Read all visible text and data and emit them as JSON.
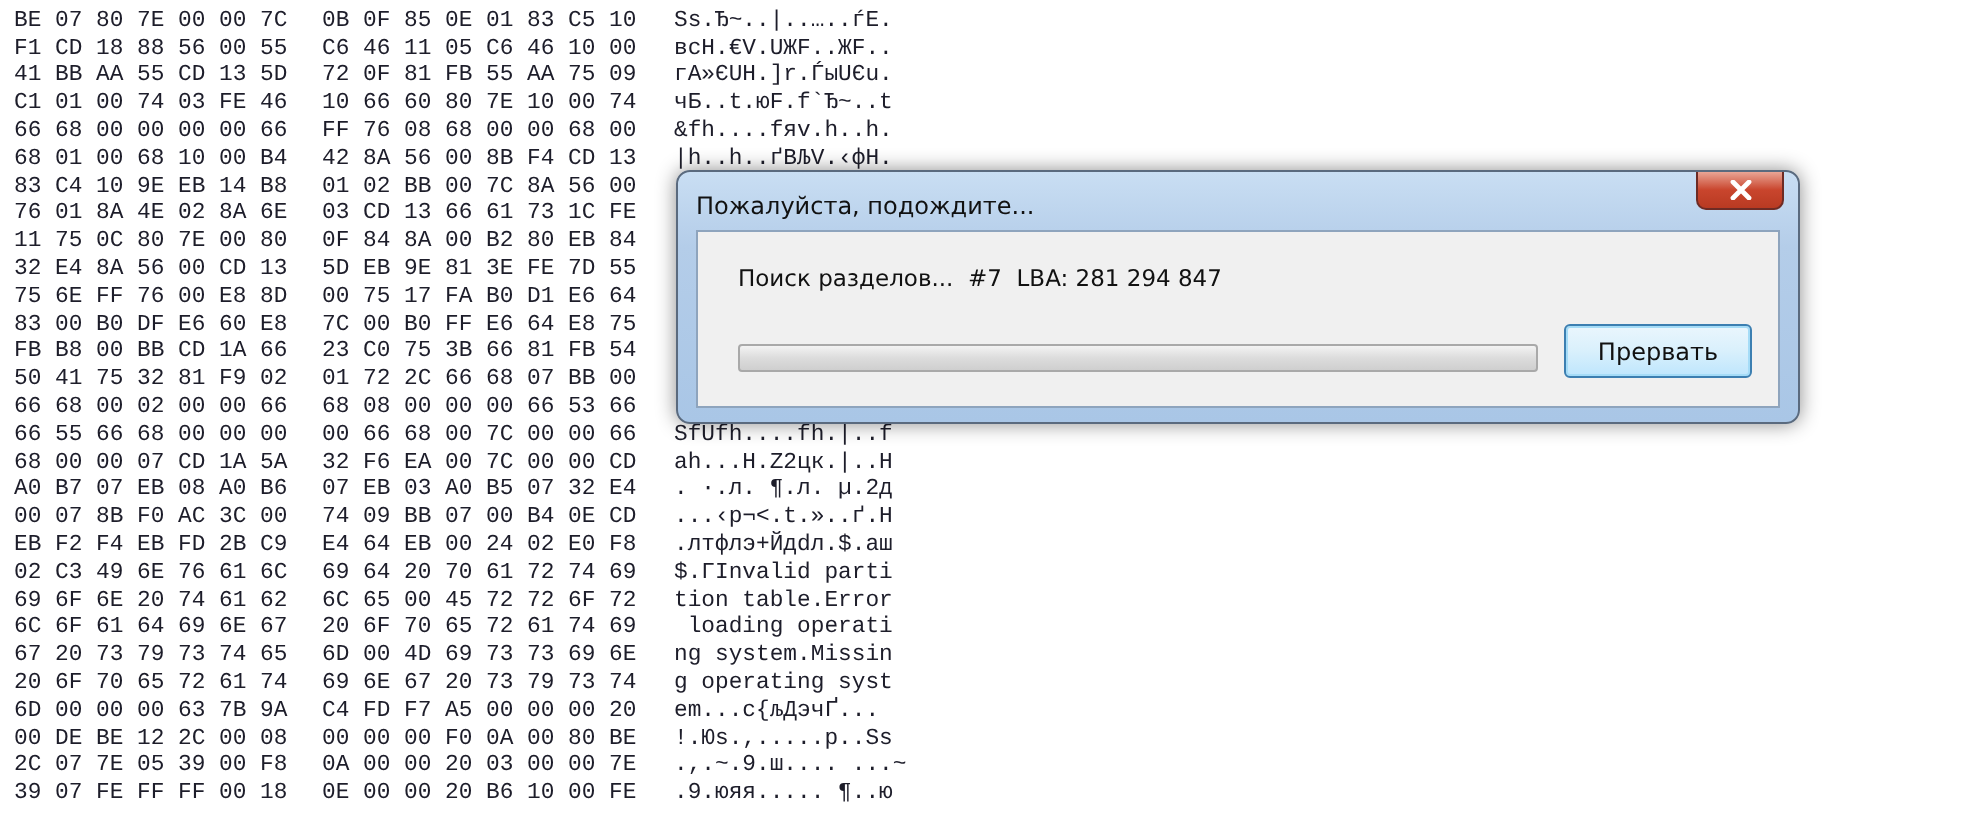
{
  "hex_view": {
    "rows": [
      {
        "bytes": [
          "BE",
          "07",
          "80",
          "7E",
          "00",
          "00",
          "7C",
          "0B",
          "0F",
          "85",
          "0E",
          "01",
          "83",
          "C5",
          "10"
        ],
        "text": "Ss.Ђ~..|..…..ѓЕ."
      },
      {
        "bytes": [
          "F1",
          "CD",
          "18",
          "88",
          "56",
          "00",
          "55",
          "C6",
          "46",
          "11",
          "05",
          "C6",
          "46",
          "10",
          "00"
        ],
        "text": "всН.€V.UЖF..ЖF.."
      },
      {
        "bytes": [
          "41",
          "BB",
          "AA",
          "55",
          "CD",
          "13",
          "5D",
          "72",
          "0F",
          "81",
          "FB",
          "55",
          "AA",
          "75",
          "09"
        ],
        "text": "гA»ЄUН.]r.ЃыUЄu."
      },
      {
        "bytes": [
          "C1",
          "01",
          "00",
          "74",
          "03",
          "FE",
          "46",
          "10",
          "66",
          "60",
          "80",
          "7E",
          "10",
          "00",
          "74"
        ],
        "text": "чБ..t.юF.f`Ђ~..t"
      },
      {
        "bytes": [
          "66",
          "68",
          "00",
          "00",
          "00",
          "00",
          "66",
          "FF",
          "76",
          "08",
          "68",
          "00",
          "00",
          "68",
          "00"
        ],
        "text": "&fh....fяv.h..h."
      },
      {
        "bytes": [
          "68",
          "01",
          "00",
          "68",
          "10",
          "00",
          "B4",
          "42",
          "8A",
          "56",
          "00",
          "8B",
          "F4",
          "CD",
          "13"
        ],
        "text": "|h..h..ґBЉV.‹фН."
      },
      {
        "bytes": [
          "83",
          "C4",
          "10",
          "9E",
          "EB",
          "14",
          "B8",
          "01",
          "02",
          "BB",
          "00",
          "7C",
          "8A",
          "56",
          "00"
        ]
      },
      {
        "bytes": [
          "76",
          "01",
          "8A",
          "4E",
          "02",
          "8A",
          "6E",
          "03",
          "CD",
          "13",
          "66",
          "61",
          "73",
          "1C",
          "FE"
        ]
      },
      {
        "bytes": [
          "11",
          "75",
          "0C",
          "80",
          "7E",
          "00",
          "80",
          "0F",
          "84",
          "8A",
          "00",
          "B2",
          "80",
          "EB",
          "84"
        ]
      },
      {
        "bytes": [
          "32",
          "E4",
          "8A",
          "56",
          "00",
          "CD",
          "13",
          "5D",
          "EB",
          "9E",
          "81",
          "3E",
          "FE",
          "7D",
          "55"
        ]
      },
      {
        "bytes": [
          "75",
          "6E",
          "FF",
          "76",
          "00",
          "E8",
          "8D",
          "00",
          "75",
          "17",
          "FA",
          "B0",
          "D1",
          "E6",
          "64"
        ]
      },
      {
        "bytes": [
          "83",
          "00",
          "B0",
          "DF",
          "E6",
          "60",
          "E8",
          "7C",
          "00",
          "B0",
          "FF",
          "E6",
          "64",
          "E8",
          "75"
        ]
      },
      {
        "bytes": [
          "FB",
          "B8",
          "00",
          "BB",
          "CD",
          "1A",
          "66",
          "23",
          "C0",
          "75",
          "3B",
          "66",
          "81",
          "FB",
          "54"
        ]
      },
      {
        "bytes": [
          "50",
          "41",
          "75",
          "32",
          "81",
          "F9",
          "02",
          "01",
          "72",
          "2C",
          "66",
          "68",
          "07",
          "BB",
          "00"
        ]
      },
      {
        "bytes": [
          "66",
          "68",
          "00",
          "02",
          "00",
          "00",
          "66",
          "68",
          "08",
          "00",
          "00",
          "00",
          "66",
          "53",
          "66"
        ]
      },
      {
        "bytes": [
          "66",
          "55",
          "66",
          "68",
          "00",
          "00",
          "00",
          "00",
          "66",
          "68",
          "00",
          "7C",
          "00",
          "00",
          "66"
        ],
        "text": "SfUfh....fh.|..f"
      },
      {
        "bytes": [
          "68",
          "00",
          "00",
          "07",
          "CD",
          "1A",
          "5A",
          "32",
          "F6",
          "EA",
          "00",
          "7C",
          "00",
          "00",
          "CD"
        ],
        "text": "ah...Н.Z2цк.|..Н"
      },
      {
        "bytes": [
          "A0",
          "B7",
          "07",
          "EB",
          "08",
          "A0",
          "B6",
          "07",
          "EB",
          "03",
          "A0",
          "B5",
          "07",
          "32",
          "E4"
        ],
        "text": ". ·.л. ¶.л. µ.2д"
      },
      {
        "bytes": [
          "00",
          "07",
          "8B",
          "F0",
          "AC",
          "3C",
          "00",
          "74",
          "09",
          "BB",
          "07",
          "00",
          "B4",
          "0E",
          "CD"
        ],
        "text": "...‹р¬<.t.»..ґ.Н"
      },
      {
        "bytes": [
          "EB",
          "F2",
          "F4",
          "EB",
          "FD",
          "2B",
          "C9",
          "E4",
          "64",
          "EB",
          "00",
          "24",
          "02",
          "E0",
          "F8"
        ],
        "text": ".лтфлэ+Йдdл.$.аш"
      },
      {
        "bytes": [
          "02",
          "C3",
          "49",
          "6E",
          "76",
          "61",
          "6C",
          "69",
          "64",
          "20",
          "70",
          "61",
          "72",
          "74",
          "69"
        ],
        "text": "$.ГInvalid parti"
      },
      {
        "bytes": [
          "69",
          "6F",
          "6E",
          "20",
          "74",
          "61",
          "62",
          "6C",
          "65",
          "00",
          "45",
          "72",
          "72",
          "6F",
          "72"
        ],
        "text": "tion table.Error"
      },
      {
        "bytes": [
          "6C",
          "6F",
          "61",
          "64",
          "69",
          "6E",
          "67",
          "20",
          "6F",
          "70",
          "65",
          "72",
          "61",
          "74",
          "69"
        ],
        "text": " loading operati"
      },
      {
        "bytes": [
          "67",
          "20",
          "73",
          "79",
          "73",
          "74",
          "65",
          "6D",
          "00",
          "4D",
          "69",
          "73",
          "73",
          "69",
          "6E"
        ],
        "text": "ng system.Missin"
      },
      {
        "bytes": [
          "20",
          "6F",
          "70",
          "65",
          "72",
          "61",
          "74",
          "69",
          "6E",
          "67",
          "20",
          "73",
          "79",
          "73",
          "74"
        ],
        "text": "g operating syst"
      },
      {
        "bytes": [
          "6D",
          "00",
          "00",
          "00",
          "63",
          "7B",
          "9A",
          "C4",
          "FD",
          "F7",
          "A5",
          "00",
          "00",
          "00",
          "20"
        ],
        "text": "em...c{љДэчҐ..."
      },
      {
        "bytes": [
          "00",
          "DE",
          "BE",
          "12",
          "2C",
          "00",
          "08",
          "00",
          "00",
          "00",
          "F0",
          "0A",
          "00",
          "80",
          "BE"
        ],
        "text": "!.Юs.,.....р..Ѕs"
      },
      {
        "bytes": [
          "2C",
          "07",
          "7E",
          "05",
          "39",
          "00",
          "F8",
          "0A",
          "00",
          "00",
          "20",
          "03",
          "00",
          "00",
          "7E"
        ],
        "text": ".,.~.9.ш.... ...~"
      },
      {
        "bytes": [
          "39",
          "07",
          "FE",
          "FF",
          "FF",
          "00",
          "18",
          "0E",
          "00",
          "00",
          "20",
          "B6",
          "10",
          "00",
          "FE"
        ],
        "text": ".9.юяя..... ¶..ю"
      }
    ]
  },
  "dialog": {
    "title": "Пожалуйста, подождите...",
    "status": "Поиск разделов...  #7  LBA: 281 294 847",
    "buttons": [
      "Прервать"
    ]
  }
}
